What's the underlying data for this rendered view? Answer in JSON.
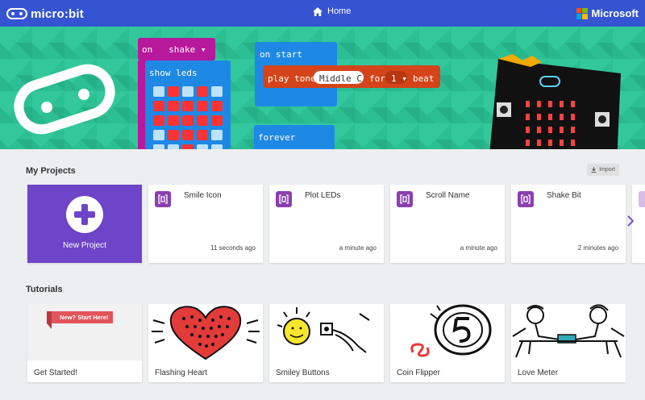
{
  "topbar": {
    "logo_text": "micro:bit",
    "home_label": "Home",
    "brand": "Microsoft",
    "color": "#3454d1"
  },
  "hero": {
    "block_on_shake": "on",
    "block_shake_value": "shake",
    "block_show_leds": "show leds",
    "block_on_start": "on start",
    "block_play_tone": "play tone",
    "block_note": "Middle C",
    "block_for": "for",
    "block_beats_value": "1",
    "block_beat": "beat",
    "block_forever": "forever"
  },
  "my_projects": {
    "title": "My Projects",
    "import_label": "Import",
    "new_project_label": "New Project",
    "projects": [
      {
        "name": "Smile Icon",
        "time": "11 seconds ago"
      },
      {
        "name": "Plot LEDs",
        "time": "a minute ago"
      },
      {
        "name": "Scroll Name",
        "time": "a minute ago"
      },
      {
        "name": "Shake Bit",
        "time": "2 minutes ago"
      }
    ]
  },
  "tutorials": {
    "title": "Tutorials",
    "items": [
      {
        "label": "Get Started!",
        "badge": "New? Start Here!"
      },
      {
        "label": "Flashing Heart"
      },
      {
        "label": "Smiley Buttons"
      },
      {
        "label": "Coin Flipper"
      },
      {
        "label": "Love Meter"
      }
    ]
  },
  "colors": {
    "accent": "#3454d1",
    "hero_green": "#2cbf94",
    "new_project_purple": "#6e44c8",
    "block_purple": "#b8189c",
    "block_blue": "#1e88e5",
    "block_red": "#d4441a",
    "ribbon_red": "#e2555b"
  },
  "icons": [
    "microbit-logo-icon",
    "home-icon",
    "microsoft-logo-icon",
    "import-icon",
    "plus-icon",
    "project-icon",
    "chevron-right-icon"
  ]
}
